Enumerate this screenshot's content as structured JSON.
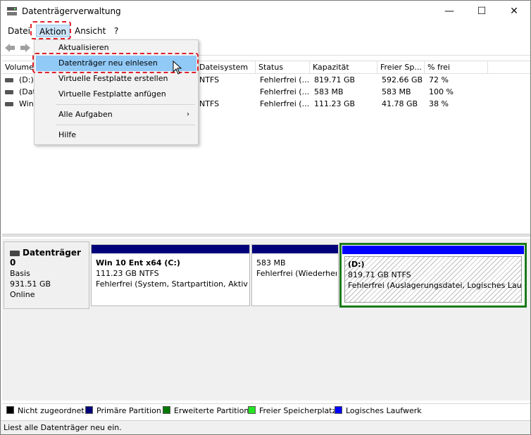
{
  "window": {
    "title": "Datenträgerverwaltung",
    "controls": {
      "minimize": "—",
      "maximize": "☐",
      "close": "✕"
    }
  },
  "menubar": {
    "items": [
      {
        "label": "Datei"
      },
      {
        "label": "Aktion"
      },
      {
        "label": "Ansicht"
      },
      {
        "label": "?"
      }
    ]
  },
  "context_menu": {
    "items": [
      {
        "label": "Aktualisieren"
      },
      {
        "label": "Datenträger neu einlesen"
      },
      {
        "label": "Virtuelle Festplatte erstellen"
      },
      {
        "label": "Virtuelle Festplatte anfügen"
      },
      {
        "label": "Alle Aufgaben",
        "submenu_arrow": "›"
      },
      {
        "label": "Hilfe"
      }
    ]
  },
  "volume_list": {
    "columns": [
      "Volume",
      "Dateisystem",
      "Status",
      "Kapazität",
      "Freier Sp...",
      "% frei"
    ],
    "rows": [
      {
        "volume": "(D:)",
        "filesystem": "NTFS",
        "status": "Fehlerfrei (...",
        "capacity": "819.71 GB",
        "free": "592.66 GB",
        "pct": "72 %"
      },
      {
        "volume": "(Dat",
        "filesystem": "",
        "status": "Fehlerfrei (...",
        "capacity": "583 MB",
        "free": "583 MB",
        "pct": "100 %"
      },
      {
        "volume": "Win",
        "filesystem": "NTFS",
        "status": "Fehlerfrei (...",
        "capacity": "111.23 GB",
        "free": "41.78 GB",
        "pct": "38 %"
      }
    ]
  },
  "disk": {
    "name": "Datenträger 0",
    "type": "Basis",
    "size": "931.51 GB",
    "state": "Online",
    "partitions": [
      {
        "name": "Win 10 Ent x64  (C:)",
        "size": "111.23 GB NTFS",
        "status": "Fehlerfrei (System, Startpartition, Aktiv, Absturzabbild, Primäre Partition)"
      },
      {
        "name": "",
        "size": "583 MB",
        "status": "Fehlerfrei (Wiederherstellungspartition)"
      },
      {
        "name": "(D:)",
        "size": "819.71 GB NTFS",
        "status": "Fehlerfrei (Auslagerungsdatei, Logisches Laufwerk)"
      }
    ]
  },
  "legend": [
    {
      "label": "Nicht zugeordnet",
      "color": "#000000"
    },
    {
      "label": "Primäre Partition",
      "color": "#00007a"
    },
    {
      "label": "Erweiterte Partition",
      "color": "#007a00"
    },
    {
      "label": "Freier Speicherplatz",
      "color": "#22e622"
    },
    {
      "label": "Logisches Laufwerk",
      "color": "#0000ff"
    }
  ],
  "statusbar": {
    "text": "Liest alle Datenträger neu ein."
  }
}
